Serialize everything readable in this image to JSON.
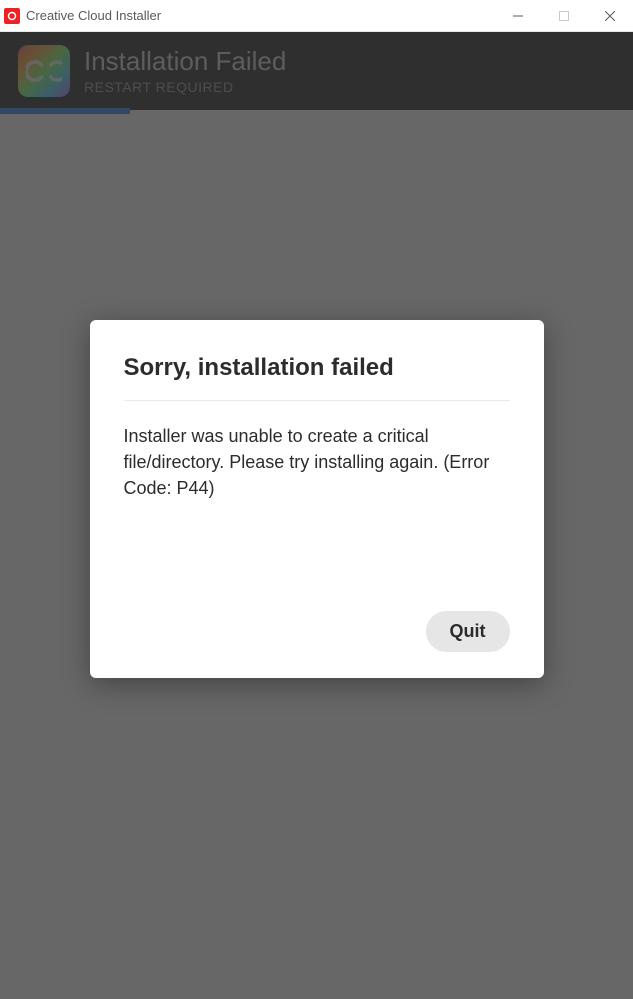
{
  "window": {
    "title": "Creative Cloud Installer"
  },
  "header": {
    "title": "Installation Failed",
    "subtitle": "RESTART REQUIRED",
    "progress_percent": 20.5
  },
  "dialog": {
    "title": "Sorry, installation failed",
    "message": "Installer was unable to create a critical file/directory. Please try installing again. (Error Code: P44)",
    "quit_label": "Quit"
  }
}
